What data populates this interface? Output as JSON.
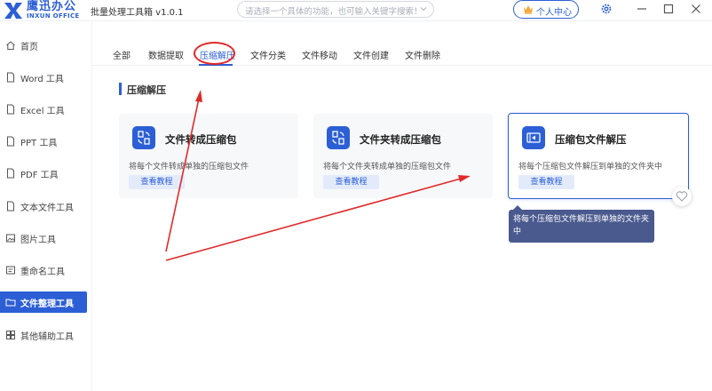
{
  "app": {
    "logo_cn": "鹰迅办公",
    "logo_en": "INXUN OFFICE",
    "title": "批量处理工具箱 v1.0.1",
    "brand_color": "#2c5fd6"
  },
  "search": {
    "placeholder": "请选择一个具体的功能，也可输入关键字搜索！"
  },
  "header": {
    "user_center_label": "个人中心"
  },
  "sidebar": {
    "items": [
      {
        "label": "首页",
        "icon": "home-icon"
      },
      {
        "label": "Word 工具",
        "icon": "document-icon"
      },
      {
        "label": "Excel 工具",
        "icon": "document-icon"
      },
      {
        "label": "PPT 工具",
        "icon": "document-icon"
      },
      {
        "label": "PDF 工具",
        "icon": "document-icon"
      },
      {
        "label": "文本文件工具",
        "icon": "document-icon"
      },
      {
        "label": "图片工具",
        "icon": "image-icon"
      },
      {
        "label": "重命名工具",
        "icon": "rename-icon"
      },
      {
        "label": "文件整理工具",
        "icon": "folder-icon",
        "active": true
      },
      {
        "label": "其他辅助工具",
        "icon": "grid-icon"
      }
    ]
  },
  "tabs": [
    "全部",
    "数据提取",
    "压缩解压",
    "文件分类",
    "文件移动",
    "文件创建",
    "文件删除"
  ],
  "active_tab": "压缩解压",
  "section": {
    "title": "压缩解压"
  },
  "cards": [
    {
      "title": "文件转成压缩包",
      "desc": "将每个文件转成单独的压缩包文件",
      "button": "查看教程"
    },
    {
      "title": "文件夹转成压缩包",
      "desc": "将每个文件夹转成单独的压缩包文件",
      "button": "查看教程"
    },
    {
      "title": "压缩包文件解压",
      "desc": "将每个压缩包文件解压到单独的文件夹中",
      "button": "查看教程"
    }
  ],
  "tooltip": {
    "text": "将每个压缩包文件解压到单独的文件夹中"
  },
  "annotation_color": "#e02a2a"
}
